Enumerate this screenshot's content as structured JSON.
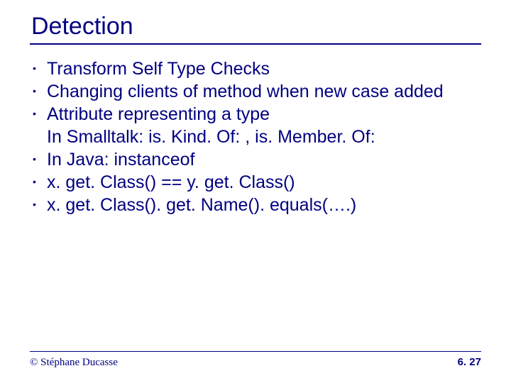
{
  "slide": {
    "title": "Detection",
    "bullets": [
      "Transform Self Type Checks",
      "Changing clients of method when new case added",
      "Attribute representing a type\nIn Smalltalk: is. Kind. Of: , is. Member. Of:",
      "In Java: instanceof",
      "x. get. Class() == y. get. Class()",
      "x. get. Class(). get. Name(). equals(….)"
    ],
    "footer": {
      "copyright": "© Stéphane Ducasse",
      "page": "6. 27"
    }
  }
}
